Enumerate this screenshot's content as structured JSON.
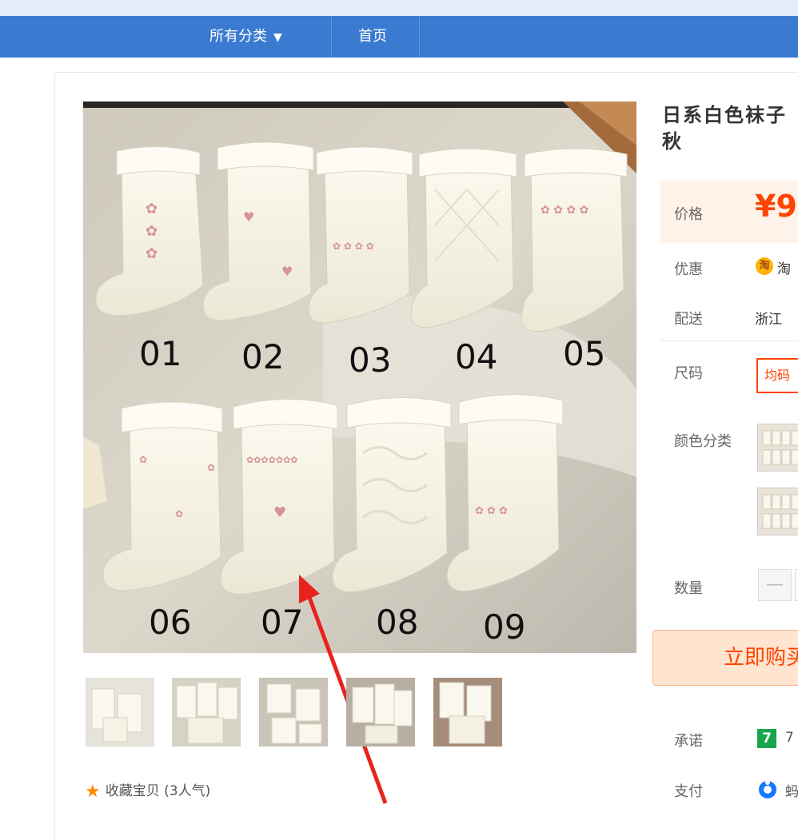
{
  "nav": {
    "categories_label": "所有分类",
    "categories_arrow": "▼",
    "home_label": "首页"
  },
  "product": {
    "title": "日系白色袜子 秋",
    "image_numbers_top": [
      "01",
      "02",
      "03",
      "04",
      "05"
    ],
    "image_numbers_bottom": [
      "06",
      "07",
      "08",
      "09"
    ],
    "thumbnail_count": 5
  },
  "favorite": {
    "label": "收藏宝贝 (3人气)"
  },
  "details": {
    "price_label": "价格",
    "price_value": "¥9",
    "promo_label": "优惠",
    "promo_icon_text": "淘",
    "promo_text": "淘",
    "shipping_label": "配送",
    "shipping_text": "浙江",
    "size_label": "尺码",
    "size_option": "均码",
    "color_label": "颜色分类",
    "quantity_label": "数量",
    "quantity_minus": "—",
    "buy_label": "立即购买",
    "promise_label": "承诺",
    "promise_icon": "7",
    "promise_text": "7",
    "pay_label": "支付",
    "pay_text": "蚂"
  },
  "colors": {
    "nav": "#3a7bd1",
    "accent": "#ff4400",
    "price_bg": "#fff2e8",
    "buy_bg": "#ffe4d0"
  }
}
